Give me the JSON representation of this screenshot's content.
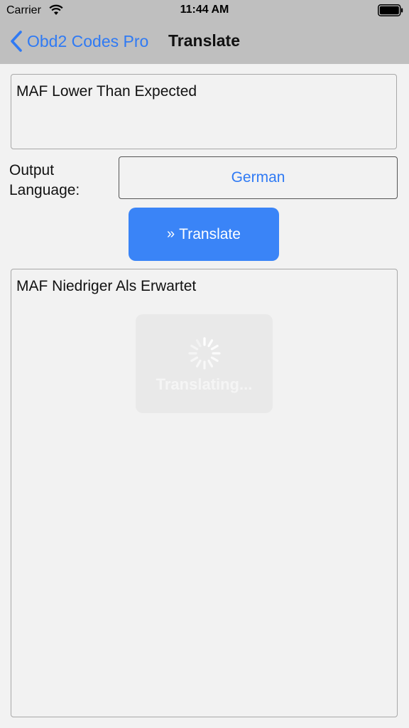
{
  "status_bar": {
    "carrier": "Carrier",
    "time": "11:44 AM",
    "icons": [
      "wifi-icon",
      "battery-icon"
    ]
  },
  "nav": {
    "back_label": "Obd2 Codes Pro",
    "title": "Translate"
  },
  "input": {
    "text": "MAF Lower Than Expected"
  },
  "language": {
    "label_line1": "Output",
    "label_line2": "Language:",
    "selected": "German"
  },
  "translate_button": {
    "icon": "double-chevron-right",
    "label": "Translate"
  },
  "output": {
    "text": "MAF Niedriger Als Erwartet"
  },
  "loading": {
    "label": "Translating...",
    "icon": "spinner-icon"
  },
  "colors": {
    "accent": "#2f7af4",
    "button": "#3a84f7",
    "header": "#bfbfbf",
    "background": "#f2f2f2"
  }
}
